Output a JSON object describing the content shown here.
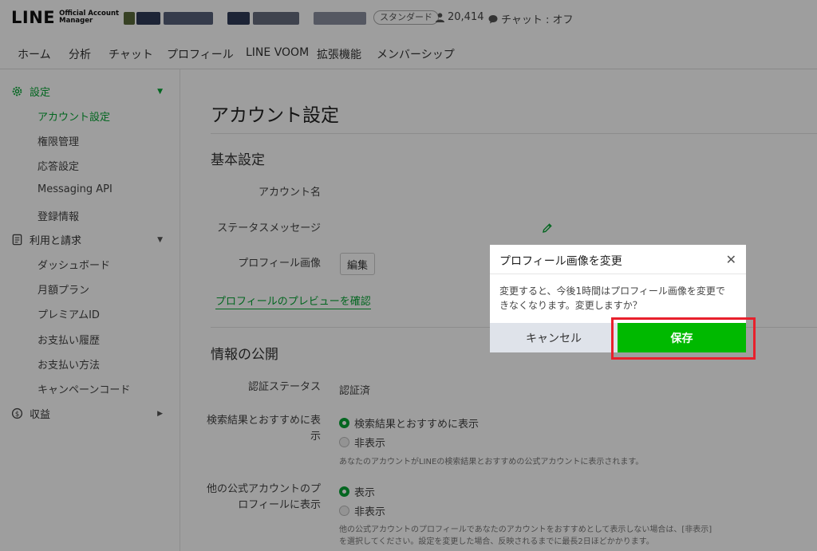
{
  "header": {
    "logo_main": "LINE",
    "logo_sub_line1": "Official Account",
    "logo_sub_line2": "Manager",
    "plan_badge": "スタンダード",
    "friends_count": "20,414",
    "chat_status": "チャット : オフ"
  },
  "nav": {
    "items": [
      "ホーム",
      "分析",
      "チャット",
      "プロフィール",
      "LINE VOOM",
      "拡張機能",
      "メンバーシップ"
    ]
  },
  "sidebar": {
    "settings_group": "設定",
    "settings_items": [
      "アカウント設定",
      "権限管理",
      "応答設定",
      "Messaging API",
      "登録情報"
    ],
    "billing_group": "利用と請求",
    "billing_items": [
      "ダッシュボード",
      "月額プラン",
      "プレミアムID",
      "お支払い履歴",
      "お支払い方法",
      "キャンペーンコード"
    ],
    "revenue_group": "収益"
  },
  "main": {
    "page_title": "アカウント設定",
    "basic_section": "基本設定",
    "account_name_label": "アカウント名",
    "status_message_label": "ステータスメッセージ",
    "profile_image_label": "プロフィール画像",
    "edit_button": "編集",
    "preview_link": "プロフィールのプレビューを確認",
    "public_section": "情報の公開",
    "verify_status_label": "認証ステータス",
    "verify_status_value": "認証済",
    "search_label_line1": "検索結果とおすすめに表",
    "search_label_line2": "示",
    "search_option_show": "検索結果とおすすめに表示",
    "search_option_hide": "非表示",
    "search_note": "あなたのアカウントがLINEの検索結果とおすすめの公式アカウントに表示されます。",
    "other_label_line1": "他の公式アカウントのプ",
    "other_label_line2": "ロフィールに表示",
    "other_option_show": "表示",
    "other_option_hide": "非表示",
    "other_note_line1": "他の公式アカウントのプロフィールであなたのアカウントをおすすめとして表示しない場合は、[非表示]",
    "other_note_line2": "を選択してください。設定を変更した場合、反映されるまでに最長2日ほどかかります。"
  },
  "modal": {
    "title": "プロフィール画像を変更",
    "body_line1": "変更すると、今後1時間はプロフィール画像を変更で",
    "body_line2": "きなくなります。変更しますか？",
    "cancel_label": "キャンセル",
    "save_label": "保存"
  },
  "colors": {
    "accent_green": "#06a534",
    "save_button": "#00b900",
    "highlight_red": "#e8202c"
  },
  "icons": {
    "friends": "person-icon",
    "chat": "chat-bubble-icon",
    "settings": "gear-icon",
    "billing": "receipt-icon",
    "revenue": "dollar-coin-icon",
    "status_edit": "pencil-icon",
    "modal_close": "close-icon"
  }
}
